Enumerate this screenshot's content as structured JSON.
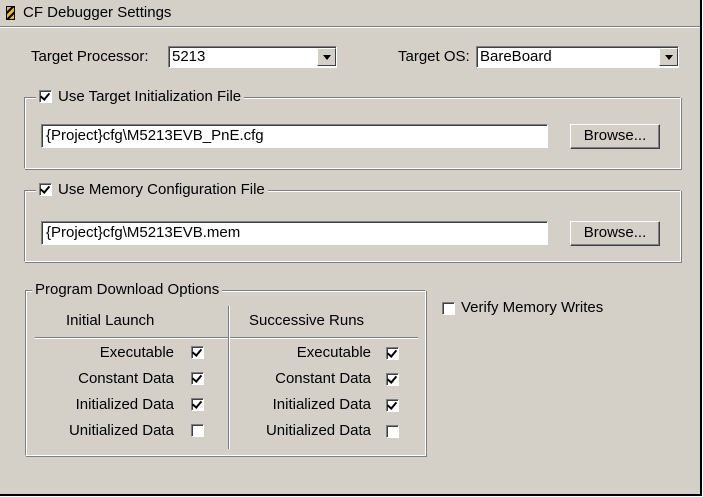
{
  "window": {
    "title": "CF Debugger Settings"
  },
  "target": {
    "processor_label": "Target Processor:",
    "processor_value": "5213",
    "os_label": "Target OS:",
    "os_value": "BareBoard"
  },
  "init_file": {
    "label": "Use Target Initialization File",
    "checked": true,
    "path": "{Project}cfg\\M5213EVB_PnE.cfg",
    "browse_label": "Browse..."
  },
  "mem_file": {
    "label": "Use Memory Configuration File",
    "checked": true,
    "path": "{Project}cfg\\M5213EVB.mem",
    "browse_label": "Browse..."
  },
  "download": {
    "group_label": "Program Download Options",
    "initial_header": "Initial Launch",
    "successive_header": "Successive Runs",
    "rows": [
      {
        "label": "Executable",
        "initial": true,
        "successive": true
      },
      {
        "label": "Constant Data",
        "initial": true,
        "successive": true
      },
      {
        "label": "Initialized Data",
        "initial": true,
        "successive": true
      },
      {
        "label": "Unitialized Data",
        "initial": false,
        "successive": false
      }
    ]
  },
  "verify": {
    "label": "Verify Memory Writes",
    "checked": false
  }
}
